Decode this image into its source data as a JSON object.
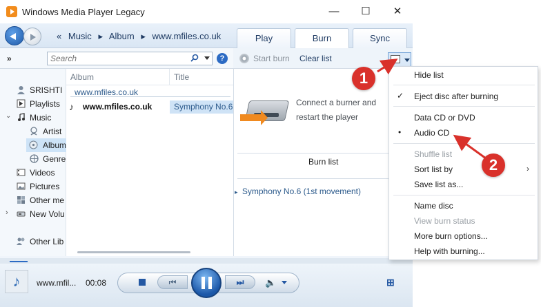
{
  "window": {
    "title": "Windows Media Player Legacy",
    "minimize": "—",
    "maximize": "☐",
    "close": "✕"
  },
  "nav": {
    "breadcrumb_prefix": "«",
    "breadcrumb": [
      "Music",
      "Album",
      "www.mfiles.co.uk"
    ],
    "separator": "▸",
    "tabs": [
      "Play",
      "Burn",
      "Sync"
    ]
  },
  "toolbar": {
    "more": "»",
    "search_placeholder": "Search",
    "help": "?"
  },
  "tree": {
    "items": [
      {
        "label": "SRISHTI",
        "icon": "user-icon"
      },
      {
        "label": "Playlists",
        "icon": "playlist-icon"
      },
      {
        "label": "Music",
        "icon": "music-note-icon"
      },
      {
        "label": "Artist",
        "icon": "artist-icon"
      },
      {
        "label": "Album",
        "icon": "album-icon"
      },
      {
        "label": "Genre",
        "icon": "genre-icon"
      },
      {
        "label": "Videos",
        "icon": "video-icon"
      },
      {
        "label": "Pictures",
        "icon": "picture-icon"
      },
      {
        "label": "Other me",
        "icon": "other-media-icon"
      },
      {
        "label": "New Volu",
        "icon": "drive-icon"
      },
      {
        "label": "Other Lib",
        "icon": "other-libraries-icon"
      }
    ]
  },
  "library": {
    "columns": [
      "Album",
      "Title"
    ],
    "group_header": "www.mfiles.co.uk",
    "album_name": "www.mfiles.co.uk",
    "track_title": "Symphony No.6"
  },
  "burn": {
    "start_burn": "Start burn",
    "clear_list": "Clear list",
    "connect_message_line1": "Connect a burner and",
    "connect_message_line2": "restart the player",
    "burn_list_label": "Burn list",
    "burn_items": [
      "Symphony No.6 (1st movement)"
    ]
  },
  "menu": {
    "items": [
      {
        "label": "Hide list",
        "mark": "",
        "disabled": false
      },
      {
        "label": "Eject disc after burning",
        "mark": "✓",
        "disabled": false
      },
      {
        "label": "Data CD or DVD",
        "mark": "",
        "disabled": false
      },
      {
        "label": "Audio CD",
        "mark": "•",
        "disabled": false
      },
      {
        "label": "Shuffle list",
        "mark": "",
        "disabled": true
      },
      {
        "label": "Sort list by",
        "mark": "",
        "disabled": false,
        "submenu": "›"
      },
      {
        "label": "Save list as...",
        "mark": "",
        "disabled": false
      },
      {
        "label": "Name disc",
        "mark": "",
        "disabled": false
      },
      {
        "label": "View burn status",
        "mark": "",
        "disabled": true
      },
      {
        "label": "More burn options...",
        "mark": "",
        "disabled": false
      },
      {
        "label": "Help with burning...",
        "mark": "",
        "disabled": false
      }
    ]
  },
  "player": {
    "now_playing": "www.mfil...",
    "time": "00:08",
    "prev": "⏮",
    "next": "⏭",
    "volume": "🔈",
    "switch_view": "⊞"
  },
  "annotations": {
    "step1": "1",
    "step2": "2",
    "color": "#d9312b"
  }
}
